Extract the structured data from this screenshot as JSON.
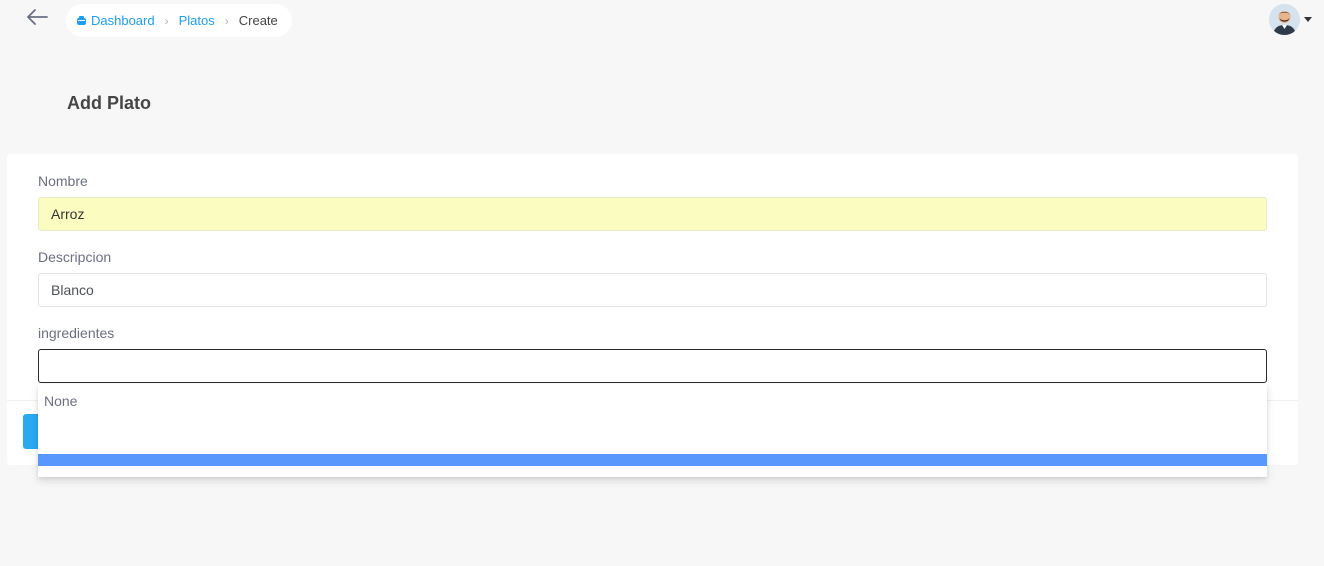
{
  "breadcrumb": {
    "items": [
      {
        "label": "Dashboard"
      },
      {
        "label": "Platos"
      },
      {
        "label": "Create"
      }
    ]
  },
  "page": {
    "title": "Add Plato"
  },
  "form": {
    "nombre": {
      "label": "Nombre",
      "value": "Arroz"
    },
    "descripcion": {
      "label": "Descripcion",
      "value": "Blanco"
    },
    "ingredientes": {
      "label": "ingredientes",
      "value": ""
    }
  },
  "dropdown": {
    "options": [
      {
        "label": "None"
      }
    ]
  },
  "colors": {
    "accent": "#1e9ff2",
    "autofill": "#fafcc0",
    "highlight": "#5897fb",
    "button": "#29aaf0"
  },
  "icons": {
    "back": "arrow-left-icon",
    "home": "home-icon",
    "separator": "chevron-right-icon",
    "caret": "caret-down-icon"
  }
}
